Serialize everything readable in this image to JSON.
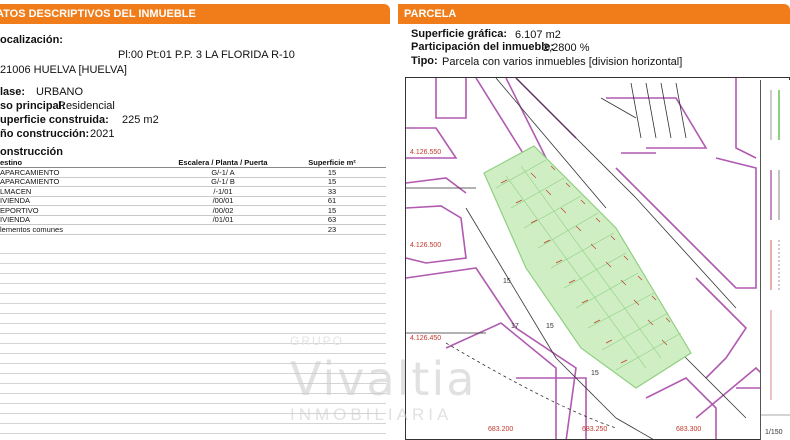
{
  "left_panel": {
    "header": "ATOS DESCRIPTIVOS DEL INMUEBLE",
    "localizacion_label": "ocalización:",
    "localizacion_line1": "Pl:00 Pt:01 P.P. 3 LA FLORIDA R-10",
    "localizacion_line2": "21006 HUELVA [HUELVA]",
    "clase_label": "lase:",
    "clase_value": "URBANO",
    "uso_label": "so principal:",
    "uso_value": "Residencial",
    "superficie_label": "uperficie construida:",
    "superficie_value": "225 m2",
    "anio_label": "ño construcción:",
    "anio_value": "2021",
    "construccion_title": "onstrucción",
    "table_headers": [
      "estino",
      "Escalera / Planta / Puerta",
      "Superficie m²"
    ],
    "table_rows": [
      [
        "APARCAMIENTO",
        "G/-1/   A",
        "15"
      ],
      [
        "APARCAMIENTO",
        "G/-1/   B",
        "15"
      ],
      [
        "LMACEN",
        "/-1/01",
        "33"
      ],
      [
        "IVIENDA",
        "/00/01",
        "61"
      ],
      [
        "EPORTIVO",
        "/00/02",
        "15"
      ],
      [
        "IVIENDA",
        "/01/01",
        "63"
      ],
      [
        "lementos comunes",
        "",
        "23"
      ]
    ]
  },
  "right_panel": {
    "header": "PARCELA",
    "superficie_label": "Superficie gráfica:",
    "superficie_value": "6.107 m2",
    "participacion_label": "Participación del inmueble:",
    "participacion_value": "2,2800 %",
    "tipo_label": "Tipo:",
    "tipo_value": "Parcela con varios inmuebles [division horizontal]"
  },
  "map": {
    "y_labels": [
      "4.126.550",
      "4.126.500",
      "4.126.450"
    ],
    "x_labels": [
      "683.200",
      "683.250",
      "683.300"
    ],
    "numbers": [
      "15",
      "17",
      "15",
      "15"
    ],
    "scale": "1/150",
    "colors": {
      "parcel_fill": "#cfeec4",
      "parcel_line": "#8fcf80",
      "plot_outline": "#b05ab0",
      "red_marks": "#c0392b"
    }
  },
  "watermark": {
    "small": "GRUPO",
    "big": "Vivaltia",
    "sub": "INMOBILIARIA"
  }
}
